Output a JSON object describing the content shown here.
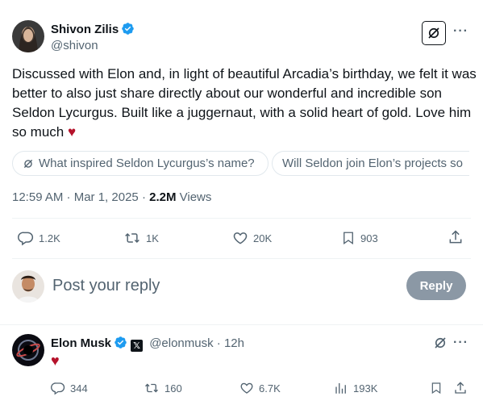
{
  "post": {
    "author_name": "Shivon Zilis",
    "author_handle": "@shivon",
    "text": "Discussed with Elon and, in light of beautiful Arcadia’s birthday, we felt it was better to also just share directly about our wonderful and incredible son Seldon Lycurgus. Built like a juggernaut, with a solid heart of gold. Love him so much",
    "emoji": "♥",
    "grok_prompts": [
      "What inspired Seldon Lycurgus’s name?",
      "Will Seldon join Elon’s projects so"
    ],
    "timestamp": "12:59 AM · Mar 1, 2025",
    "separator": "·",
    "views_count": "2.2M",
    "views_label": "Views",
    "stats": {
      "replies": "1.2K",
      "reposts": "1K",
      "likes": "20K",
      "bookmarks": "903"
    }
  },
  "reply_box": {
    "placeholder": "Post your reply",
    "button": "Reply"
  },
  "reply": {
    "author_name": "Elon Musk",
    "author_handle": "@elonmusk",
    "time": "· 12h",
    "affiliation_badge": "𝕏",
    "text": "♥",
    "stats": {
      "replies": "344",
      "reposts": "160",
      "likes": "6.7K",
      "views": "193K"
    }
  },
  "colors": {
    "text": "#0f1419",
    "secondary": "#536471",
    "verified": "#1d9bf0",
    "heart": "#b5122b",
    "reply_button_disabled": "#8b98a5"
  },
  "icons": [
    "verified-badge-icon",
    "grok-icon",
    "more-icon",
    "reply-icon",
    "repost-icon",
    "like-icon",
    "bookmark-icon",
    "share-icon",
    "views-icon"
  ]
}
